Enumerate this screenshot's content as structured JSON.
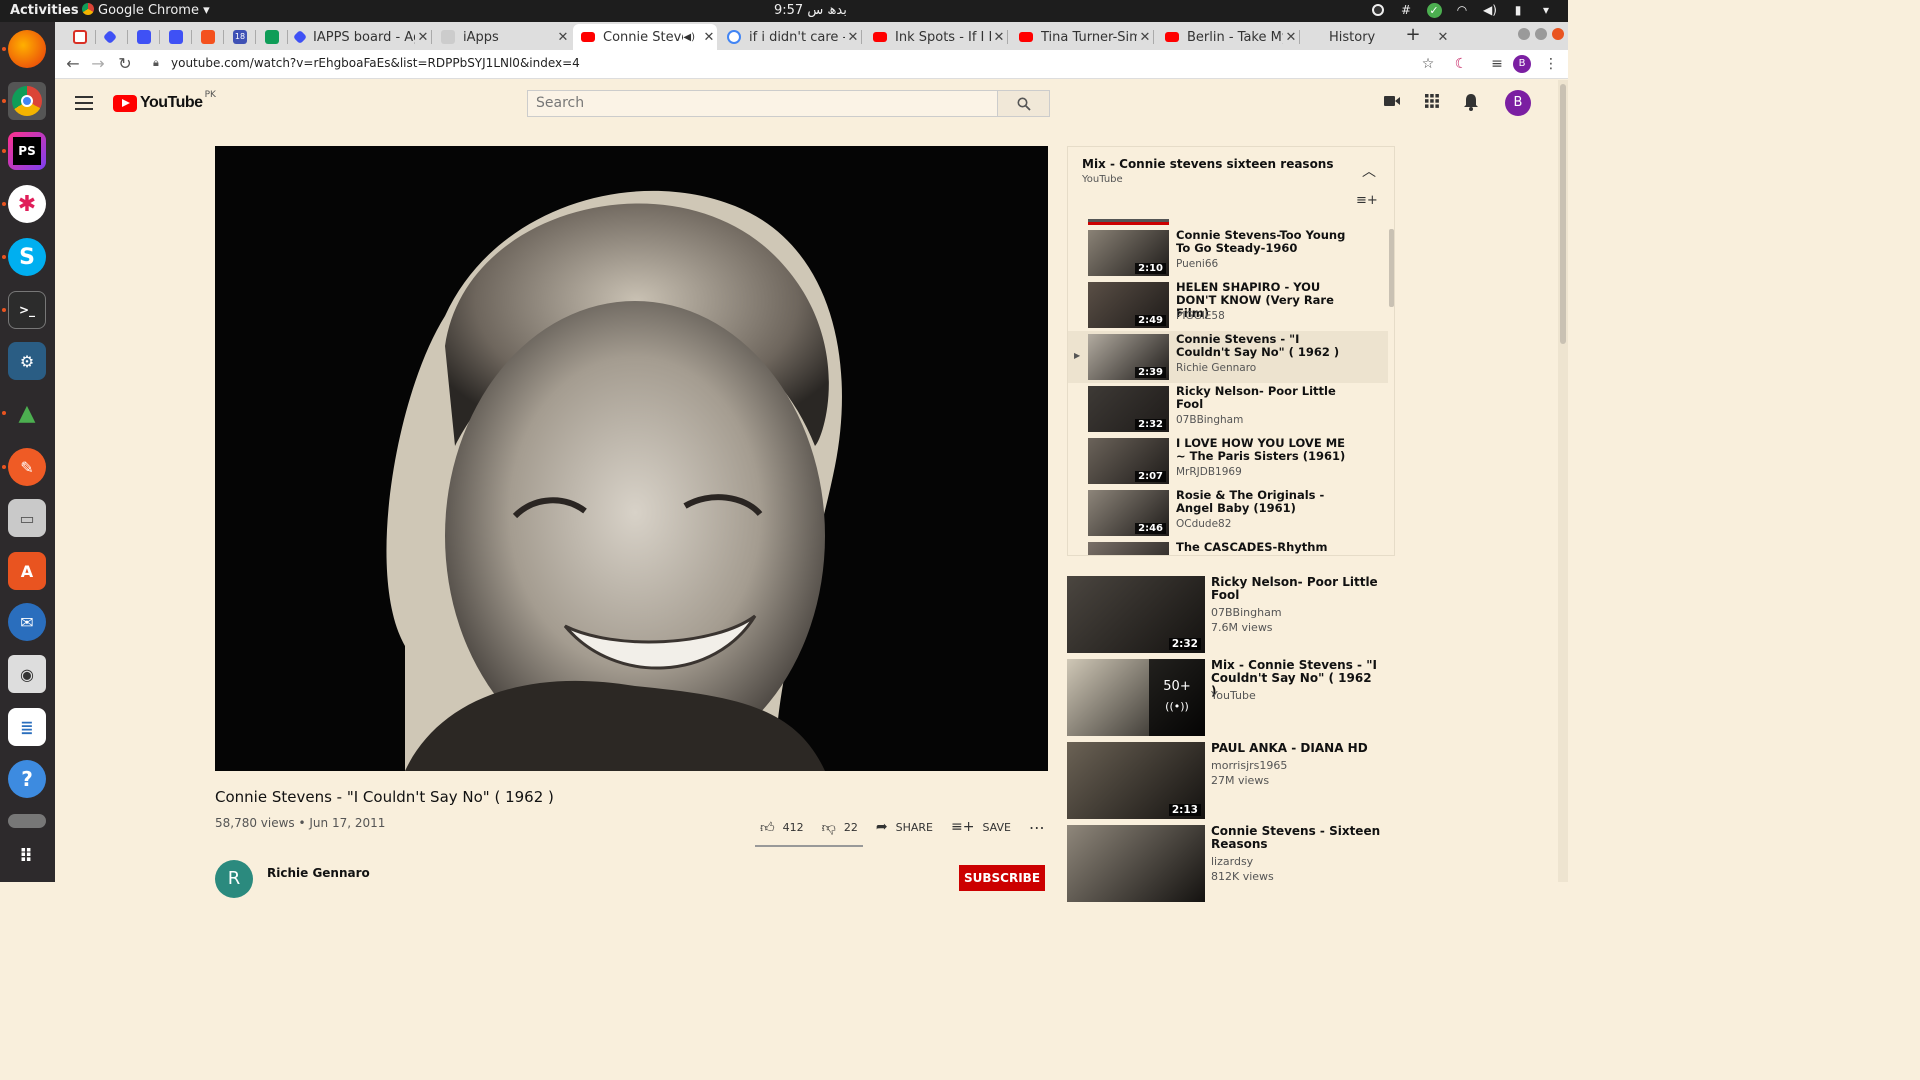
{
  "system": {
    "activities": "Activities",
    "app_name": "Google Chrome",
    "clock": "9:57 بدھ س"
  },
  "tabs": [
    {
      "label": "",
      "favicon": "gmail"
    },
    {
      "label": "",
      "favicon": "app"
    },
    {
      "label": "",
      "favicon": "app"
    },
    {
      "label": "",
      "favicon": "app"
    },
    {
      "label": "",
      "favicon": "app"
    },
    {
      "label": "18",
      "favicon": "calendar"
    },
    {
      "label": "",
      "favicon": "sheets"
    },
    {
      "label": "IAPPS board - Ag",
      "favicon": "app"
    },
    {
      "label": "iApps",
      "favicon": "app"
    },
    {
      "label": "Connie Steven",
      "favicon": "youtube"
    },
    {
      "label": "if i didn't care - G",
      "favicon": "google"
    },
    {
      "label": "Ink Spots - If I Dic",
      "favicon": "youtube"
    },
    {
      "label": "Tina Turner-Simp",
      "favicon": "youtube"
    },
    {
      "label": "Berlin - Take My B",
      "favicon": "youtube"
    },
    {
      "label": "History",
      "favicon": "history"
    }
  ],
  "omnibox": {
    "url": "youtube.com/watch?v=rEhgboaFaEs&list=RDPPbSYJ1LNl0&index=4"
  },
  "youtube": {
    "logo_text": "YouTube",
    "country": "PK",
    "search_placeholder": "Search",
    "avatar_letter": "B"
  },
  "video": {
    "title": "Connie Stevens - \"I Couldn't Say No\" ( 1962 )",
    "meta": "58,780 views • Jun 17, 2011",
    "likes": "412",
    "dislikes": "22",
    "share": "SHARE",
    "save": "SAVE",
    "channel": "Richie Gennaro",
    "channel_initial": "R",
    "subscribe": "SUBSCRIBE"
  },
  "playlist": {
    "title": "Mix - Connie stevens sixteen reasons",
    "subtitle": "YouTube",
    "items": [
      {
        "title": "Connie Stevens-Too Young To Go Steady-1960",
        "channel": "Pueni66",
        "duration": "2:10",
        "active": false
      },
      {
        "title": "HELEN SHAPIRO - YOU DON'T KNOW (Very Rare Film)",
        "channel": "PIGGIE58",
        "duration": "2:49",
        "active": false
      },
      {
        "title": "Connie Stevens - \"I Couldn't Say No\" ( 1962 )",
        "channel": "Richie Gennaro",
        "duration": "2:39",
        "active": true
      },
      {
        "title": "Ricky Nelson- Poor Little Fool",
        "channel": "07BBingham",
        "duration": "2:32",
        "active": false
      },
      {
        "title": "I LOVE HOW YOU LOVE ME ~ The Paris Sisters (1961)",
        "channel": "MrRJDB1969",
        "duration": "2:07",
        "active": false
      },
      {
        "title": "Rosie & The Originals - Angel Baby (1961)",
        "channel": "OCdude82",
        "duration": "2:46",
        "active": false
      },
      {
        "title": "The CASCADES-Rhythm Of the",
        "channel": "",
        "duration": "",
        "active": false
      }
    ]
  },
  "recommendations": [
    {
      "title": "Ricky Nelson- Poor Little Fool",
      "channel": "07BBingham",
      "views": "7.6M views",
      "duration": "2:32"
    },
    {
      "title": "Mix - Connie Stevens - \"I Couldn't Say No\" ( 1962 )",
      "channel": "YouTube",
      "views": "",
      "duration": "",
      "mix_count": "50+"
    },
    {
      "title": "PAUL ANKA - DIANA HD",
      "channel": "morrisjrs1965",
      "views": "27M views",
      "duration": "2:13"
    },
    {
      "title": "Connie Stevens - Sixteen Reasons",
      "channel": "lizardsy",
      "views": "812K views",
      "duration": ""
    }
  ]
}
